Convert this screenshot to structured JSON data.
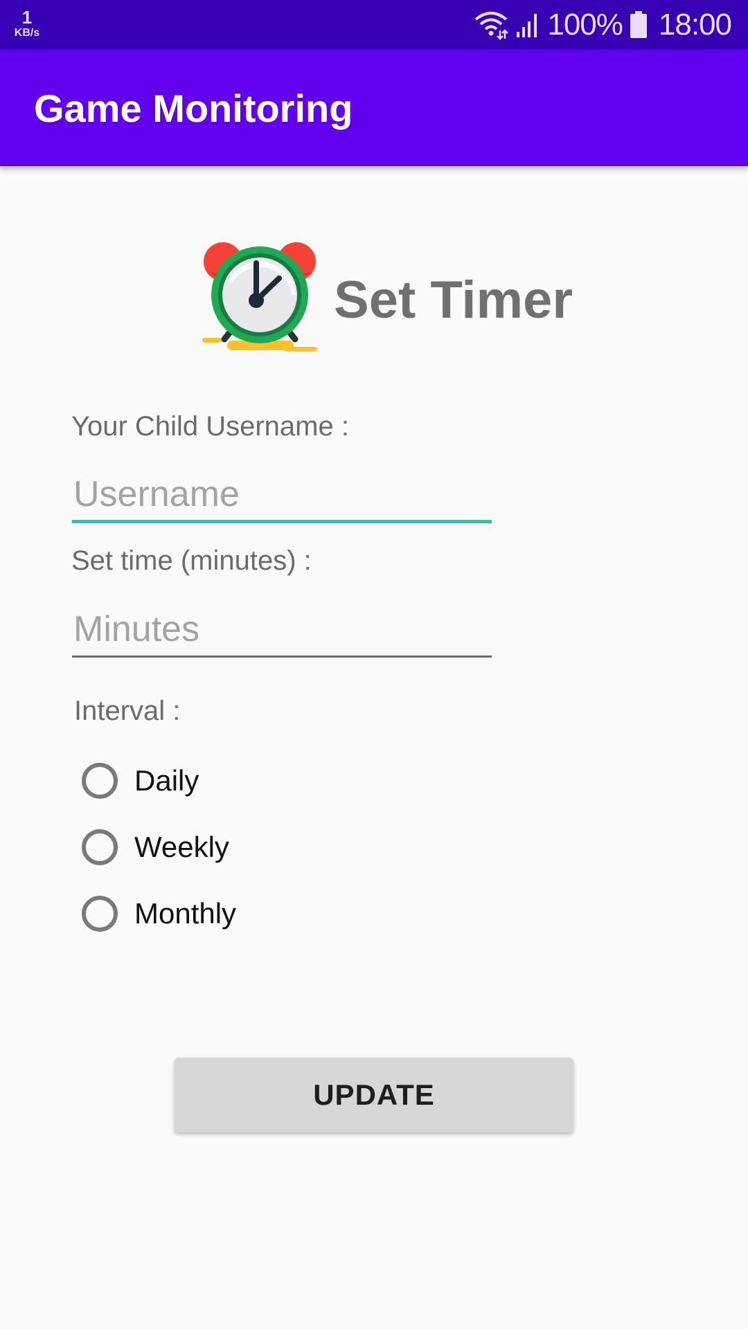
{
  "status_bar": {
    "net_speed": "1",
    "net_speed_unit": "KB/s",
    "battery": "100%",
    "time": "18:00",
    "icons": [
      "wifi-icon",
      "cell-signal-icon",
      "battery-icon"
    ]
  },
  "app_bar": {
    "title": "Game Monitoring"
  },
  "header": {
    "icon": "alarm-clock-icon",
    "title": "Set Timer"
  },
  "form": {
    "username_label": "Your Child Username :",
    "username_placeholder": "Username",
    "username_value": "",
    "minutes_label": "Set time (minutes) :",
    "minutes_placeholder": "Minutes",
    "minutes_value": "",
    "interval_label": "Interval :",
    "interval_options": [
      {
        "label": "Daily",
        "selected": false
      },
      {
        "label": "Weekly",
        "selected": false
      },
      {
        "label": "Monthly",
        "selected": false
      }
    ],
    "update_label": "UPDATE"
  },
  "colors": {
    "status_bar": "#3700b3",
    "app_bar": "#6200ee",
    "focus_accent": "#19cbbe",
    "button": "#d6d7d7",
    "background": "#fafafa"
  }
}
